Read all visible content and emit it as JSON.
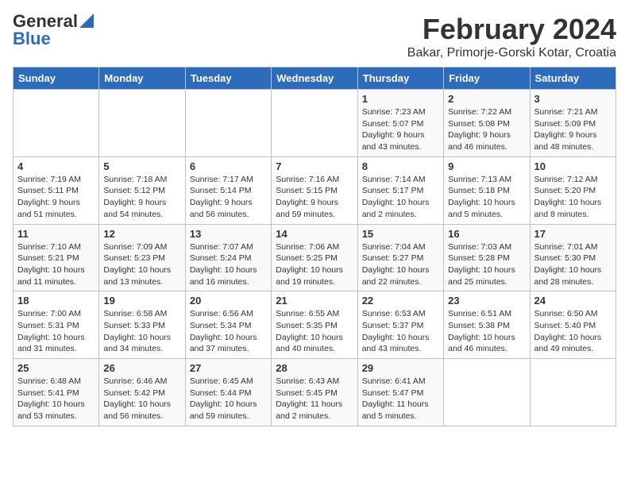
{
  "header": {
    "logo_general": "General",
    "logo_blue": "Blue",
    "month": "February 2024",
    "location": "Bakar, Primorje-Gorski Kotar, Croatia"
  },
  "weekdays": [
    "Sunday",
    "Monday",
    "Tuesday",
    "Wednesday",
    "Thursday",
    "Friday",
    "Saturday"
  ],
  "weeks": [
    [
      {
        "day": "",
        "info": ""
      },
      {
        "day": "",
        "info": ""
      },
      {
        "day": "",
        "info": ""
      },
      {
        "day": "",
        "info": ""
      },
      {
        "day": "1",
        "info": "Sunrise: 7:23 AM\nSunset: 5:07 PM\nDaylight: 9 hours\nand 43 minutes."
      },
      {
        "day": "2",
        "info": "Sunrise: 7:22 AM\nSunset: 5:08 PM\nDaylight: 9 hours\nand 46 minutes."
      },
      {
        "day": "3",
        "info": "Sunrise: 7:21 AM\nSunset: 5:09 PM\nDaylight: 9 hours\nand 48 minutes."
      }
    ],
    [
      {
        "day": "4",
        "info": "Sunrise: 7:19 AM\nSunset: 5:11 PM\nDaylight: 9 hours\nand 51 minutes."
      },
      {
        "day": "5",
        "info": "Sunrise: 7:18 AM\nSunset: 5:12 PM\nDaylight: 9 hours\nand 54 minutes."
      },
      {
        "day": "6",
        "info": "Sunrise: 7:17 AM\nSunset: 5:14 PM\nDaylight: 9 hours\nand 56 minutes."
      },
      {
        "day": "7",
        "info": "Sunrise: 7:16 AM\nSunset: 5:15 PM\nDaylight: 9 hours\nand 59 minutes."
      },
      {
        "day": "8",
        "info": "Sunrise: 7:14 AM\nSunset: 5:17 PM\nDaylight: 10 hours\nand 2 minutes."
      },
      {
        "day": "9",
        "info": "Sunrise: 7:13 AM\nSunset: 5:18 PM\nDaylight: 10 hours\nand 5 minutes."
      },
      {
        "day": "10",
        "info": "Sunrise: 7:12 AM\nSunset: 5:20 PM\nDaylight: 10 hours\nand 8 minutes."
      }
    ],
    [
      {
        "day": "11",
        "info": "Sunrise: 7:10 AM\nSunset: 5:21 PM\nDaylight: 10 hours\nand 11 minutes."
      },
      {
        "day": "12",
        "info": "Sunrise: 7:09 AM\nSunset: 5:23 PM\nDaylight: 10 hours\nand 13 minutes."
      },
      {
        "day": "13",
        "info": "Sunrise: 7:07 AM\nSunset: 5:24 PM\nDaylight: 10 hours\nand 16 minutes."
      },
      {
        "day": "14",
        "info": "Sunrise: 7:06 AM\nSunset: 5:25 PM\nDaylight: 10 hours\nand 19 minutes."
      },
      {
        "day": "15",
        "info": "Sunrise: 7:04 AM\nSunset: 5:27 PM\nDaylight: 10 hours\nand 22 minutes."
      },
      {
        "day": "16",
        "info": "Sunrise: 7:03 AM\nSunset: 5:28 PM\nDaylight: 10 hours\nand 25 minutes."
      },
      {
        "day": "17",
        "info": "Sunrise: 7:01 AM\nSunset: 5:30 PM\nDaylight: 10 hours\nand 28 minutes."
      }
    ],
    [
      {
        "day": "18",
        "info": "Sunrise: 7:00 AM\nSunset: 5:31 PM\nDaylight: 10 hours\nand 31 minutes."
      },
      {
        "day": "19",
        "info": "Sunrise: 6:58 AM\nSunset: 5:33 PM\nDaylight: 10 hours\nand 34 minutes."
      },
      {
        "day": "20",
        "info": "Sunrise: 6:56 AM\nSunset: 5:34 PM\nDaylight: 10 hours\nand 37 minutes."
      },
      {
        "day": "21",
        "info": "Sunrise: 6:55 AM\nSunset: 5:35 PM\nDaylight: 10 hours\nand 40 minutes."
      },
      {
        "day": "22",
        "info": "Sunrise: 6:53 AM\nSunset: 5:37 PM\nDaylight: 10 hours\nand 43 minutes."
      },
      {
        "day": "23",
        "info": "Sunrise: 6:51 AM\nSunset: 5:38 PM\nDaylight: 10 hours\nand 46 minutes."
      },
      {
        "day": "24",
        "info": "Sunrise: 6:50 AM\nSunset: 5:40 PM\nDaylight: 10 hours\nand 49 minutes."
      }
    ],
    [
      {
        "day": "25",
        "info": "Sunrise: 6:48 AM\nSunset: 5:41 PM\nDaylight: 10 hours\nand 53 minutes."
      },
      {
        "day": "26",
        "info": "Sunrise: 6:46 AM\nSunset: 5:42 PM\nDaylight: 10 hours\nand 56 minutes."
      },
      {
        "day": "27",
        "info": "Sunrise: 6:45 AM\nSunset: 5:44 PM\nDaylight: 10 hours\nand 59 minutes."
      },
      {
        "day": "28",
        "info": "Sunrise: 6:43 AM\nSunset: 5:45 PM\nDaylight: 11 hours\nand 2 minutes."
      },
      {
        "day": "29",
        "info": "Sunrise: 6:41 AM\nSunset: 5:47 PM\nDaylight: 11 hours\nand 5 minutes."
      },
      {
        "day": "",
        "info": ""
      },
      {
        "day": "",
        "info": ""
      }
    ]
  ]
}
